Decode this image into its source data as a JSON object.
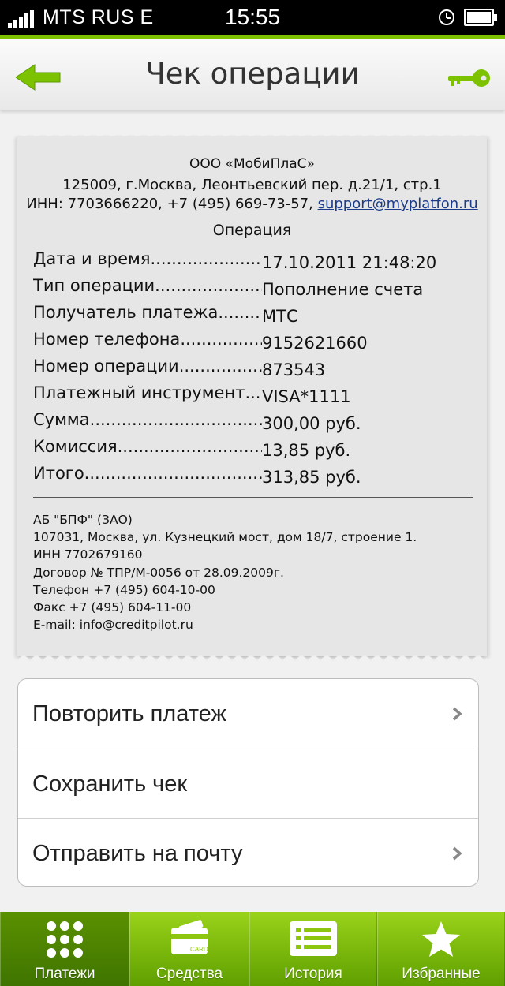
{
  "status_bar": {
    "carrier": "MTS RUS  E",
    "time": "15:55"
  },
  "header": {
    "title": "Чек операции",
    "back_icon": "arrow-left-icon",
    "key_icon": "key-icon"
  },
  "receipt": {
    "company": "ООО «МобиПлаС»",
    "address": "125009, г.Москва, Леонтьевский пер. д.21/1, стр.1",
    "inn_phone": "ИНН: 7703666220, +7 (495) 669-73-57,",
    "email": "support@myplatfon.ru",
    "operation_title": "Операция",
    "rows": [
      {
        "label": "Дата и время",
        "value": "17.10.2011 21:48:20"
      },
      {
        "label": "Тип операции",
        "value": "Пополнение счета"
      },
      {
        "label": "Получатель платежа",
        "value": "МТС"
      },
      {
        "label": "Номер телефона",
        "value": "9152621660"
      },
      {
        "label": "Номер операции",
        "value": "873543"
      },
      {
        "label": "Платежный инструмент",
        "value": "VISA*1111"
      },
      {
        "label": "Сумма",
        "value": "300,00 руб."
      },
      {
        "label": "Комиссия",
        "value": "13,85 руб."
      },
      {
        "label": "Итого",
        "value": "313,85 руб."
      }
    ],
    "bank": [
      "АБ \"БПФ\" (ЗАО)",
      "107031, Москва, ул. Кузнецкий мост, дом 18/7, строение 1.",
      "ИНН 7702679160",
      "Договор № ТПР/М-0056 от 28.09.2009г.",
      "Телефон +7 (495) 604-10-00",
      "Факс +7 (495) 604-11-00",
      "E-mail: info@creditpilot.ru"
    ]
  },
  "actions": [
    {
      "label": "Повторить платеж",
      "chevron": true
    },
    {
      "label": "Сохранить чек",
      "chevron": false
    },
    {
      "label": "Отправить на почту",
      "chevron": true
    }
  ],
  "tabs": [
    {
      "label": "Платежи",
      "icon": "grid-icon",
      "active": true
    },
    {
      "label": "Средства",
      "icon": "card-icon",
      "card_text": "CARD",
      "active": false
    },
    {
      "label": "История",
      "icon": "list-icon",
      "active": false
    },
    {
      "label": "Избранные",
      "icon": "star-icon",
      "active": false
    }
  ],
  "colors": {
    "accent": "#7cc200",
    "tab_active": "#4a8200",
    "link": "#1a3c8a"
  }
}
